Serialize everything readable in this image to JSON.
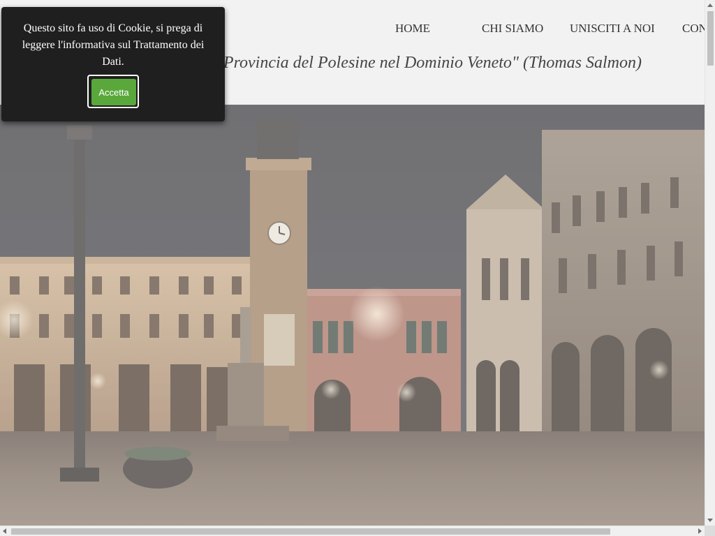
{
  "nav": {
    "items": [
      {
        "label": "HOME"
      },
      {
        "label": "CHI SIAMO"
      },
      {
        "label": "UNISCITI A NOI"
      },
      {
        "label": "CON"
      }
    ]
  },
  "header": {
    "tagline": "Provincia del Polesine nel Dominio Veneto\" (Thomas Salmon)"
  },
  "cookie_banner": {
    "message": "Questo sito fa uso di Cookie, si prega di leggere l'informativa sul Trattamento dei Dati.",
    "accept_label": "Accetta"
  },
  "colors": {
    "accept_button": "#5aa83b",
    "banner_background": "#1f1f1f",
    "page_background": "#f2f2f2"
  }
}
